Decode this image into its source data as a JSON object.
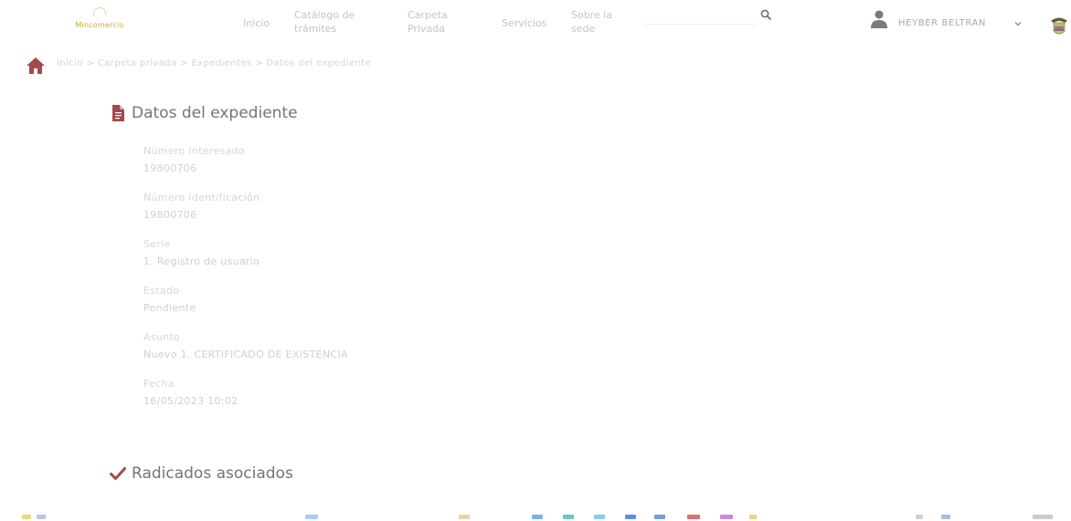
{
  "header": {
    "logo_text": "Mincomercio",
    "nav": [
      {
        "label": "Inicio"
      },
      {
        "label": "Catálogo de trámites"
      },
      {
        "label": "Carpeta Privada"
      },
      {
        "label": "Servicios"
      },
      {
        "label": "Sobre la sede"
      }
    ],
    "search": {
      "placeholder": "",
      "icon": "search-icon"
    },
    "user": {
      "name": "HEYBER BELTRAN",
      "icon": "user-icon"
    },
    "crest_icon": "colombia-crest-icon"
  },
  "breadcrumb": {
    "text": "Inicio > Carpeta privada > Expedientes > Datos del expediente"
  },
  "expediente": {
    "title": "Datos del expediente",
    "fields": [
      {
        "label": "Número Interesado",
        "value": "19800706"
      },
      {
        "label": "Número Identificación",
        "value": "19800706"
      },
      {
        "label": "Serie",
        "value": "1. Registro de usuario"
      },
      {
        "label": "Estado",
        "value": "Pendiente"
      },
      {
        "label": "Asunto",
        "value": "Nuevo 1. CERTIFICADO DE EXISTENCIA"
      },
      {
        "label": "Fecha",
        "value": "16/05/2023 10:02"
      }
    ]
  },
  "radicados": {
    "title": "Radicados asociados"
  },
  "colors": {
    "accent": "#a3494b",
    "user_icon": "#7a7a7a",
    "title_text": "#747474",
    "logo_gold": "#c9a845"
  }
}
